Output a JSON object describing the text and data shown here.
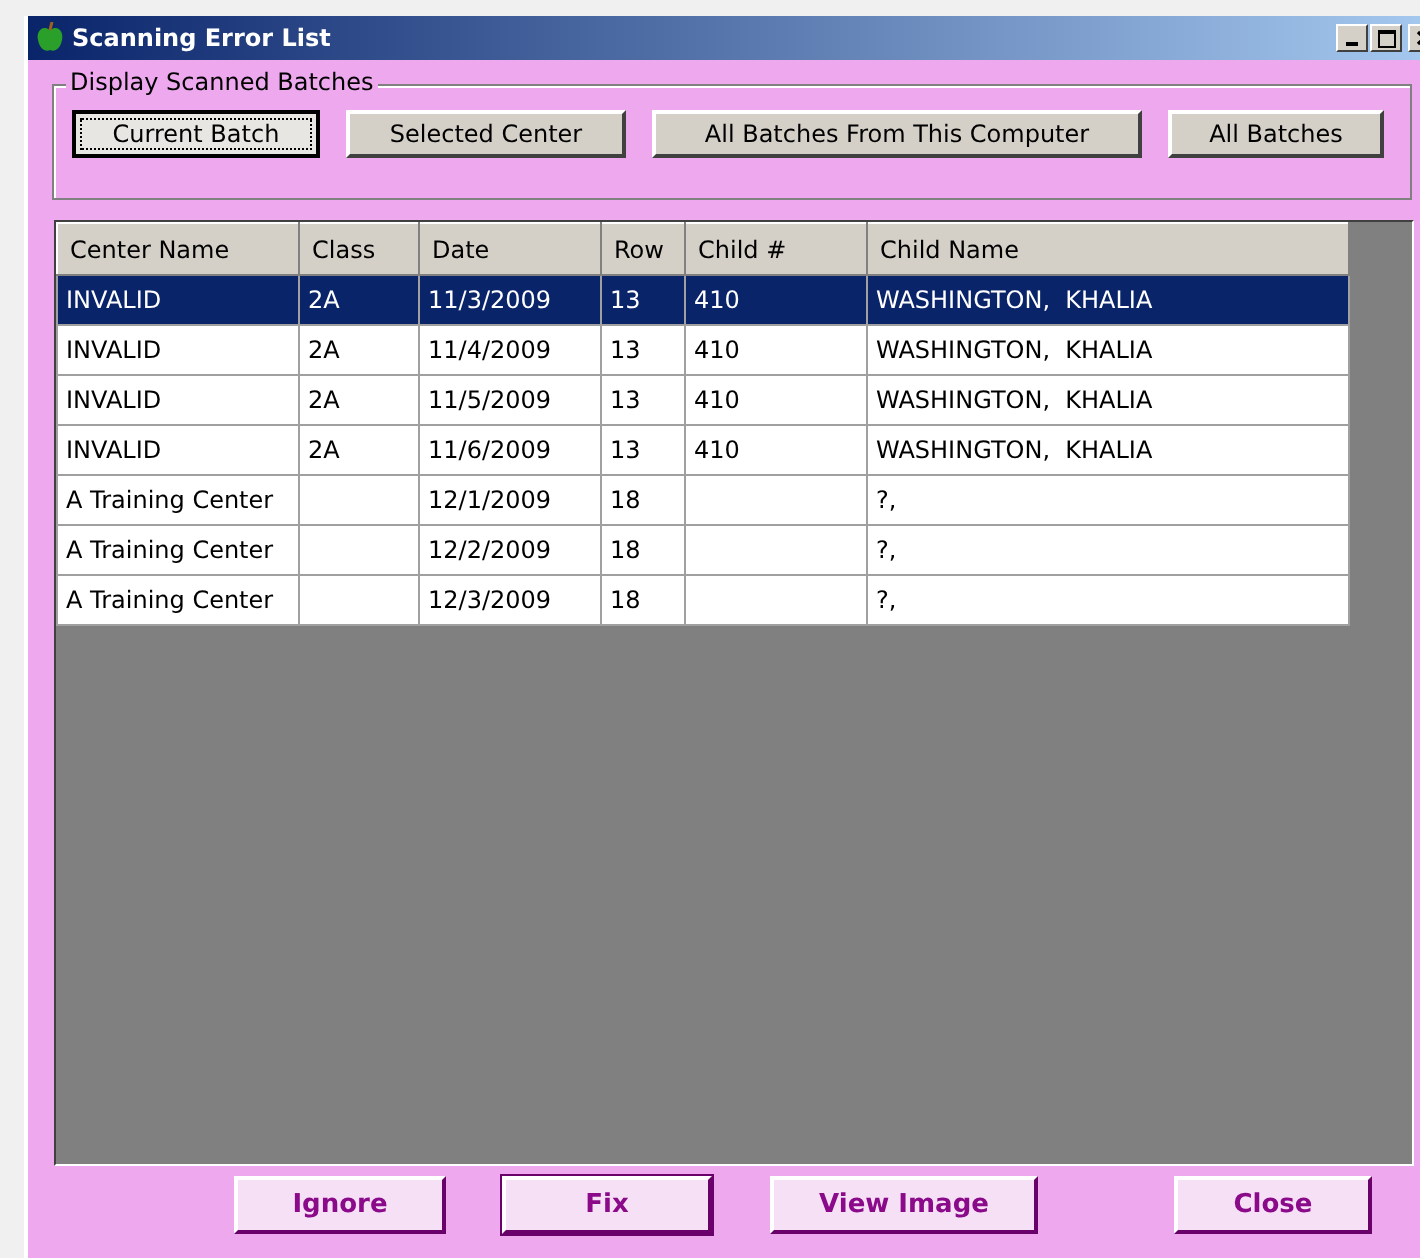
{
  "window": {
    "title": "Scanning Error List"
  },
  "batch_group": {
    "label": "Display Scanned Batches",
    "buttons": [
      {
        "label": "Current Batch",
        "selected": true
      },
      {
        "label": "Selected Center",
        "selected": false
      },
      {
        "label": "All Batches From This Computer",
        "selected": false
      },
      {
        "label": "All Batches",
        "selected": false
      }
    ]
  },
  "table": {
    "columns": [
      "Center Name",
      "Class",
      "Date",
      "Row",
      "Child #",
      "Child Name"
    ],
    "rows": [
      {
        "cells": [
          "INVALID",
          "2A",
          "11/3/2009",
          "13",
          "410",
          "WASHINGTON,  KHALIA"
        ],
        "selected": true
      },
      {
        "cells": [
          "INVALID",
          "2A",
          "11/4/2009",
          "13",
          "410",
          "WASHINGTON,  KHALIA"
        ],
        "selected": false
      },
      {
        "cells": [
          "INVALID",
          "2A",
          "11/5/2009",
          "13",
          "410",
          "WASHINGTON,  KHALIA"
        ],
        "selected": false
      },
      {
        "cells": [
          "INVALID",
          "2A",
          "11/6/2009",
          "13",
          "410",
          "WASHINGTON,  KHALIA"
        ],
        "selected": false
      },
      {
        "cells": [
          "A Training Center",
          "",
          "12/1/2009",
          "18",
          "",
          "?,"
        ],
        "selected": false
      },
      {
        "cells": [
          "A Training Center",
          "",
          "12/2/2009",
          "18",
          "",
          "?,"
        ],
        "selected": false
      },
      {
        "cells": [
          "A Training Center",
          "",
          "12/3/2009",
          "18",
          "",
          "?,"
        ],
        "selected": false
      }
    ]
  },
  "actions": [
    {
      "label": "Ignore",
      "default": false
    },
    {
      "label": "Fix",
      "default": true
    },
    {
      "label": "View Image",
      "default": false
    },
    {
      "label": "Close",
      "default": false
    }
  ]
}
